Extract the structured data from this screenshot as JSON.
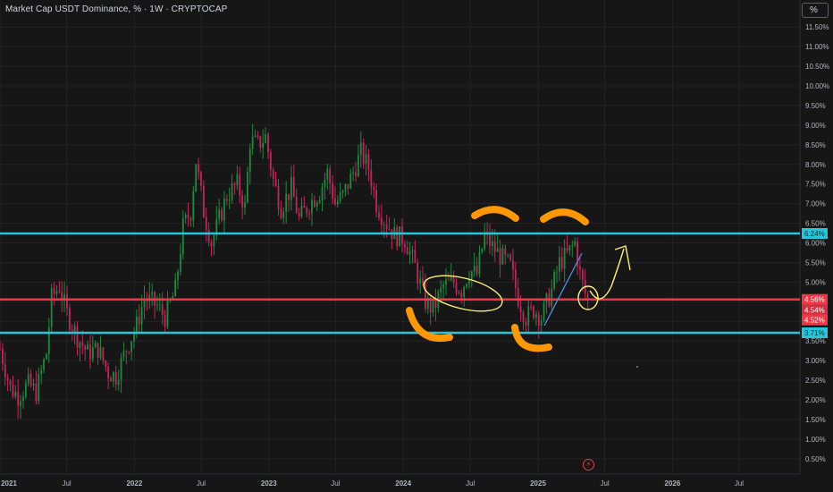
{
  "header": {
    "title": "Market Cap USDT Dominance, % · 1W · CRYPTOCAP"
  },
  "controls": {
    "unit_label": "%",
    "event_icon": "lightning-icon"
  },
  "colors": {
    "background": "#161616",
    "grid": "#232323",
    "up": "#1d8a3e",
    "down": "#c2255c",
    "cyan_line": "#26c6da",
    "pink_line": "#f23645",
    "label_pink": "#f23645",
    "annotation_orange": "#ff9800",
    "annotation_yellow": "#fff176",
    "trend_blue": "#4a90e2",
    "axis_text": "#b2b5be"
  },
  "chart_data": {
    "type": "candlestick",
    "title": "Market Cap USDT Dominance, % · 1W · CRYPTOCAP",
    "y_unit": "%",
    "ylim": [
      0.3,
      11.9
    ],
    "x_ticks": [
      "2021",
      "Jul",
      "2022",
      "Jul",
      "2023",
      "Jul",
      "2024",
      "Jul",
      "2025",
      "Jul",
      "2026",
      "Jul"
    ],
    "y_ticks": [
      "11.50%",
      "11.00%",
      "10.50%",
      "10.00%",
      "9.50%",
      "9.00%",
      "8.50%",
      "8.00%",
      "7.50%",
      "7.00%",
      "6.50%",
      "6.00%",
      "5.50%",
      "5.00%",
      "4.50%",
      "4.00%",
      "3.50%",
      "3.00%",
      "2.50%",
      "2.00%",
      "1.50%",
      "1.00%",
      "0.50%"
    ],
    "grid": true,
    "horizontal_levels": [
      {
        "value": 6.24,
        "label": "6.24%",
        "color": "cyan"
      },
      {
        "value": 4.56,
        "label": "4.56%",
        "color": "pink"
      },
      {
        "value": 3.71,
        "label": "3.71%",
        "color": "cyan"
      }
    ],
    "price_labels": {
      "current_high": "4.56%",
      "current_low": "4.52%",
      "current_mid": "4.54%"
    },
    "weekly_closes": [
      {
        "t": "2021-01-01",
        "v": 3.3
      },
      {
        "t": "2021-01-29",
        "v": 2.3
      },
      {
        "t": "2021-02-19",
        "v": 2.1
      },
      {
        "t": "2021-03-19",
        "v": 2.4
      },
      {
        "t": "2021-04-09",
        "v": 2.2
      },
      {
        "t": "2021-05-07",
        "v": 3.2
      },
      {
        "t": "2021-05-21",
        "v": 4.6
      },
      {
        "t": "2021-06-11",
        "v": 4.9
      },
      {
        "t": "2021-07-02",
        "v": 4.2
      },
      {
        "t": "2021-07-30",
        "v": 3.6
      },
      {
        "t": "2021-08-27",
        "v": 3.2
      },
      {
        "t": "2021-09-24",
        "v": 3.3
      },
      {
        "t": "2021-10-22",
        "v": 2.7
      },
      {
        "t": "2021-11-12",
        "v": 2.6
      },
      {
        "t": "2021-12-10",
        "v": 3.3
      },
      {
        "t": "2022-01-07",
        "v": 3.9
      },
      {
        "t": "2022-01-28",
        "v": 4.6
      },
      {
        "t": "2022-03-04",
        "v": 4.4
      },
      {
        "t": "2022-03-25",
        "v": 4.1
      },
      {
        "t": "2022-04-22",
        "v": 4.8
      },
      {
        "t": "2022-05-13",
        "v": 6.4
      },
      {
        "t": "2022-06-03",
        "v": 6.8
      },
      {
        "t": "2022-06-17",
        "v": 8.1
      },
      {
        "t": "2022-07-08",
        "v": 6.8
      },
      {
        "t": "2022-07-29",
        "v": 6.0
      },
      {
        "t": "2022-08-19",
        "v": 6.6
      },
      {
        "t": "2022-09-09",
        "v": 7.2
      },
      {
        "t": "2022-10-07",
        "v": 7.5
      },
      {
        "t": "2022-10-28",
        "v": 6.9
      },
      {
        "t": "2022-11-11",
        "v": 8.6
      },
      {
        "t": "2022-12-02",
        "v": 8.5
      },
      {
        "t": "2022-12-23",
        "v": 8.7
      },
      {
        "t": "2023-01-13",
        "v": 7.6
      },
      {
        "t": "2023-02-03",
        "v": 6.9
      },
      {
        "t": "2023-03-03",
        "v": 7.4
      },
      {
        "t": "2023-03-24",
        "v": 6.6
      },
      {
        "t": "2023-04-21",
        "v": 7.0
      },
      {
        "t": "2023-05-19",
        "v": 7.3
      },
      {
        "t": "2023-06-09",
        "v": 7.8
      },
      {
        "t": "2023-06-30",
        "v": 7.0
      },
      {
        "t": "2023-07-21",
        "v": 7.2
      },
      {
        "t": "2023-08-18",
        "v": 7.8
      },
      {
        "t": "2023-09-08",
        "v": 8.3
      },
      {
        "t": "2023-09-29",
        "v": 7.9
      },
      {
        "t": "2023-10-20",
        "v": 7.0
      },
      {
        "t": "2023-11-10",
        "v": 6.6
      },
      {
        "t": "2023-12-08",
        "v": 6.2
      },
      {
        "t": "2024-01-05",
        "v": 6.1
      },
      {
        "t": "2024-02-02",
        "v": 5.4
      },
      {
        "t": "2024-03-01",
        "v": 4.5
      },
      {
        "t": "2024-03-22",
        "v": 4.3
      },
      {
        "t": "2024-04-19",
        "v": 4.9
      },
      {
        "t": "2024-05-17",
        "v": 5.0
      },
      {
        "t": "2024-06-07",
        "v": 4.8
      },
      {
        "t": "2024-06-28",
        "v": 5.3
      },
      {
        "t": "2024-07-19",
        "v": 5.2
      },
      {
        "t": "2024-08-09",
        "v": 6.2
      },
      {
        "t": "2024-08-30",
        "v": 5.9
      },
      {
        "t": "2024-09-27",
        "v": 5.6
      },
      {
        "t": "2024-10-18",
        "v": 5.4
      },
      {
        "t": "2024-11-08",
        "v": 4.6
      },
      {
        "t": "2024-11-29",
        "v": 4.1
      },
      {
        "t": "2024-12-20",
        "v": 4.3
      },
      {
        "t": "2025-01-10",
        "v": 4.1
      },
      {
        "t": "2025-02-07",
        "v": 4.8
      },
      {
        "t": "2025-02-28",
        "v": 5.5
      },
      {
        "t": "2025-03-21",
        "v": 5.7
      },
      {
        "t": "2025-04-11",
        "v": 6.0
      },
      {
        "t": "2025-04-25",
        "v": 5.2
      },
      {
        "t": "2025-05-09",
        "v": 4.7
      },
      {
        "t": "2025-05-16",
        "v": 4.54
      }
    ]
  }
}
